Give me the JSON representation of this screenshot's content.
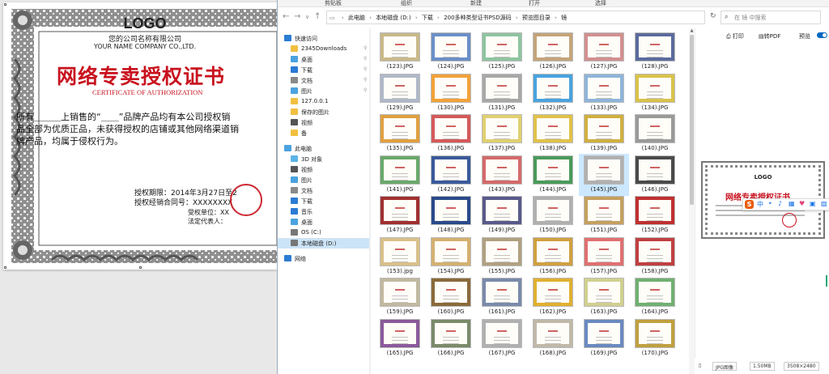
{
  "certificate": {
    "logo": "LOGO",
    "company_cn": "您的公司名称有限公司",
    "company_en": "YOUR NAME COMPANY CO.,LTD.",
    "title": "网络专卖授权证书",
    "subtitle": "CERTIFICATE OF AUTHORIZATION",
    "body_line1": "所有＿＿＿上销售的“＿＿”品牌产品均有本公司授权销",
    "body_line2": "品全部为优质正品，未获得授权的店铺或其他网络渠道销",
    "body_line3": "牌产品，均属于侵权行为。",
    "period": "授权期限：2014年3月27日至2",
    "number": "授权经销合同号：XXXXXXXX",
    "unit": "受权单位：XX",
    "legal": "法定代表人："
  },
  "ribbon": {
    "tabs": [
      "剪贴板",
      "组织",
      "新建",
      "打开",
      "选择"
    ]
  },
  "address": {
    "segments": [
      "此电脑",
      "本地磁盘 (D:)",
      "下载",
      "200多种类型证书PSD源码",
      "预览图目录",
      "镜"
    ],
    "search_placeholder": "在 镜 中搜索"
  },
  "nav": {
    "items": [
      {
        "label": "快速访问",
        "color": "#2b7cd3",
        "indent": 8,
        "pin": false
      },
      {
        "label": "2345Downloads",
        "color": "#f0c040",
        "indent": 16,
        "pin": true
      },
      {
        "label": "桌面",
        "color": "#4aa3df",
        "indent": 16,
        "pin": true
      },
      {
        "label": "下载",
        "color": "#2b7cd3",
        "indent": 16,
        "pin": true
      },
      {
        "label": "文档",
        "color": "#8a8a8a",
        "indent": 16,
        "pin": true
      },
      {
        "label": "图片",
        "color": "#4aa3df",
        "indent": 16,
        "pin": true
      },
      {
        "label": "127.0.0.1",
        "color": "#f0c040",
        "indent": 16,
        "pin": false
      },
      {
        "label": "保存的图片",
        "color": "#f0c040",
        "indent": 16,
        "pin": false
      },
      {
        "label": "视频",
        "color": "#555555",
        "indent": 16,
        "pin": false
      },
      {
        "label": "备",
        "color": "#f0c040",
        "indent": 16,
        "pin": false
      },
      {
        "label": "此电脑",
        "color": "#4aa3df",
        "indent": 8,
        "pin": false
      },
      {
        "label": "3D 对象",
        "color": "#5bb5e8",
        "indent": 16,
        "pin": false
      },
      {
        "label": "视频",
        "color": "#555555",
        "indent": 16,
        "pin": false
      },
      {
        "label": "图片",
        "color": "#4aa3df",
        "indent": 16,
        "pin": false
      },
      {
        "label": "文档",
        "color": "#8a8a8a",
        "indent": 16,
        "pin": false
      },
      {
        "label": "下载",
        "color": "#2b7cd3",
        "indent": 16,
        "pin": false
      },
      {
        "label": "音乐",
        "color": "#2b7cd3",
        "indent": 16,
        "pin": false
      },
      {
        "label": "桌面",
        "color": "#4aa3df",
        "indent": 16,
        "pin": false
      },
      {
        "label": "OS (C:)",
        "color": "#777777",
        "indent": 16,
        "pin": false
      },
      {
        "label": "本地磁盘 (D:)",
        "color": "#777777",
        "indent": 16,
        "pin": false,
        "selected": true
      },
      {
        "label": "网络",
        "color": "#2b7cd3",
        "indent": 8,
        "pin": false
      }
    ]
  },
  "files": {
    "selected": "(145).JPG",
    "items": [
      {
        "name": "(123).JPG",
        "color": "#c9b98a"
      },
      {
        "name": "(124).JPG",
        "color": "#6b8fc7"
      },
      {
        "name": "(125).JPG",
        "color": "#8fc4a0"
      },
      {
        "name": "(126).JPG",
        "color": "#c4a47a"
      },
      {
        "name": "(127).JPG",
        "color": "#d19090"
      },
      {
        "name": "(128).JPG",
        "color": "#5b6b9c"
      },
      {
        "name": "(129).JPG",
        "color": "#b0b8c8"
      },
      {
        "name": "(130).JPG",
        "color": "#f2a23a"
      },
      {
        "name": "(131).JPG",
        "color": "#a8a8a8"
      },
      {
        "name": "(132).JPG",
        "color": "#4aa3df"
      },
      {
        "name": "(133).JPG",
        "color": "#8fb4d9"
      },
      {
        "name": "(134).JPG",
        "color": "#d9c24a"
      },
      {
        "name": "(135).JPG",
        "color": "#e0a040"
      },
      {
        "name": "(136).JPG",
        "color": "#d45a5a"
      },
      {
        "name": "(137).JPG",
        "color": "#e0d070"
      },
      {
        "name": "(138).JPG",
        "color": "#e0c24a"
      },
      {
        "name": "(139).JPG",
        "color": "#d0b040"
      },
      {
        "name": "(140).JPG",
        "color": "#9a9a9a"
      },
      {
        "name": "(141).JPG",
        "color": "#6aa86a"
      },
      {
        "name": "(142).JPG",
        "color": "#3a5a9a"
      },
      {
        "name": "(143).JPG",
        "color": "#d46a6a"
      },
      {
        "name": "(144).JPG",
        "color": "#4a9a5a"
      },
      {
        "name": "(145).JPG",
        "color": "#b0b0b0"
      },
      {
        "name": "(146).JPG",
        "color": "#4a4a4a"
      },
      {
        "name": "(147).JPG",
        "color": "#a03030"
      },
      {
        "name": "(148).JPG",
        "color": "#2a4a8a"
      },
      {
        "name": "(149).JPG",
        "color": "#5a5a8a"
      },
      {
        "name": "(150).JPG",
        "color": "#b0b0b0"
      },
      {
        "name": "(151).JPG",
        "color": "#c4a060"
      },
      {
        "name": "(152).JPG",
        "color": "#c03030"
      },
      {
        "name": "(153).jpg",
        "color": "#d9c08a"
      },
      {
        "name": "(154).JPG",
        "color": "#d4b070"
      },
      {
        "name": "(155).JPG",
        "color": "#b0a080"
      },
      {
        "name": "(156).JPG",
        "color": "#d0a040"
      },
      {
        "name": "(157).JPG",
        "color": "#e07070"
      },
      {
        "name": "(158).JPG",
        "color": "#c04040"
      },
      {
        "name": "(159).JPG",
        "color": "#c0b8a0"
      },
      {
        "name": "(160).JPG",
        "color": "#8a6a3a"
      },
      {
        "name": "(161).JPG",
        "color": "#7a8aaa"
      },
      {
        "name": "(162).JPG",
        "color": "#e0b030"
      },
      {
        "name": "(163).JPG",
        "color": "#d0d090"
      },
      {
        "name": "(164).JPG",
        "color": "#70b070"
      },
      {
        "name": "(165).JPG",
        "color": "#8a5a9a"
      },
      {
        "name": "(166).JPG",
        "color": "#7a8a6a"
      },
      {
        "name": "(167).JPG",
        "color": "#b0b0b0"
      },
      {
        "name": "(168).JPG",
        "color": "#c0b8a8"
      },
      {
        "name": "(169).JPG",
        "color": "#6a8ac0"
      },
      {
        "name": "(170).JPG",
        "color": "#c0a040"
      }
    ]
  },
  "preview": {
    "print": "打印",
    "to_pdf": "转PDF",
    "preview": "预览",
    "logo": "LOGO",
    "title": "网络专卖授权证书",
    "ime_char": "中"
  },
  "status": {
    "type": "JPG图像",
    "size": "1.50MB",
    "dims": "3508×2480"
  }
}
